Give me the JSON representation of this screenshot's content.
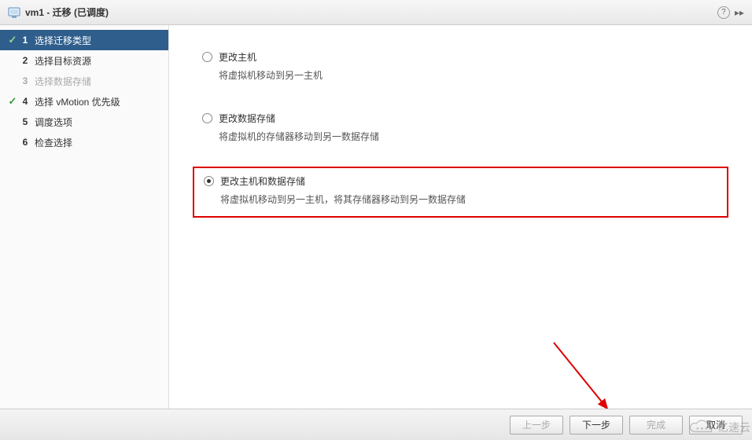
{
  "title": "vm1 - 迁移 (已调度)",
  "sidebar": {
    "steps": [
      {
        "num": "1",
        "label": "选择迁移类型",
        "checked": true,
        "active": true
      },
      {
        "num": "2",
        "label": "选择目标资源",
        "checked": false,
        "active": false
      },
      {
        "num": "3",
        "label": "选择数据存储",
        "checked": false,
        "active": false,
        "disabled": true
      },
      {
        "num": "4",
        "label": "选择 vMotion 优先级",
        "checked": true,
        "active": false
      },
      {
        "num": "5",
        "label": "调度选项",
        "checked": false,
        "active": false
      },
      {
        "num": "6",
        "label": "检查选择",
        "checked": false,
        "active": false
      }
    ]
  },
  "options": [
    {
      "title": "更改主机",
      "desc": "将虚拟机移动到另一主机",
      "selected": false
    },
    {
      "title": "更改数据存储",
      "desc": "将虚拟机的存储器移动到另一数据存储",
      "selected": false
    },
    {
      "title": "更改主机和数据存储",
      "desc": "将虚拟机移动到另一主机，将其存储器移动到另一数据存储",
      "selected": true
    }
  ],
  "footer": {
    "back": "上一步",
    "next": "下一步",
    "finish": "完成",
    "cancel": "取消"
  },
  "watermark": "亿速云"
}
